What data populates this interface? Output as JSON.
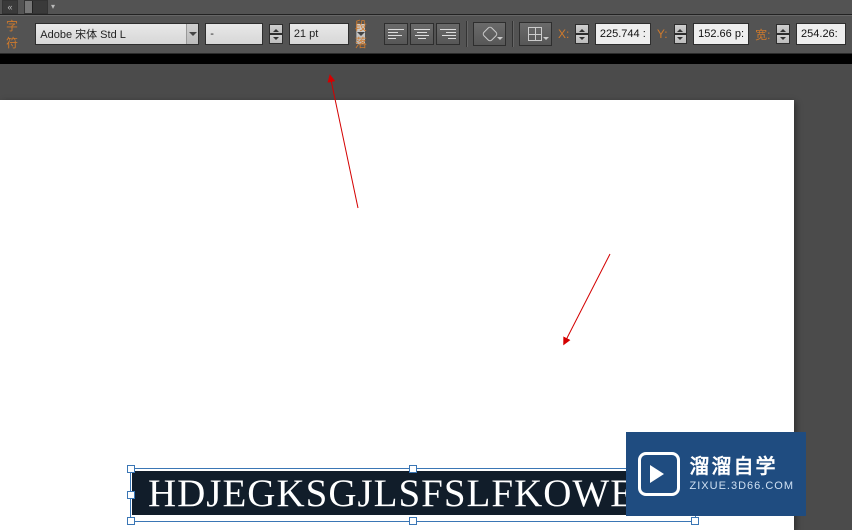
{
  "topstrip": {
    "chevron": "«"
  },
  "options": {
    "char_label": "字符",
    "font_family": "Adobe 宋体 Std L",
    "font_style": "-",
    "font_size": "21 pt",
    "para_label": "段落",
    "x_label": "X:",
    "x_value": "225.744 :",
    "y_label": "Y:",
    "y_value": "152.66 p:",
    "w_label": "宽:",
    "w_value": "254.26:"
  },
  "canvas": {
    "text": "HDJEGKSGJLSFSLFKOWEJE"
  },
  "watermark": {
    "title": "溜溜自学",
    "sub": "ZIXUE.3D66.COM"
  }
}
